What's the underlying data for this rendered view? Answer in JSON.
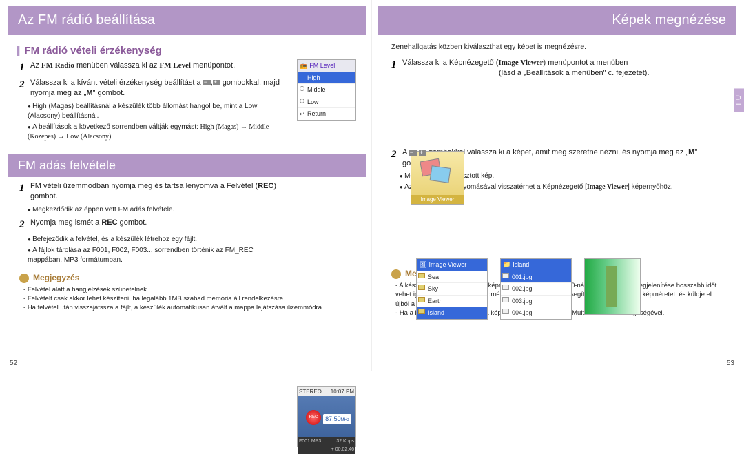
{
  "left": {
    "title": "Az FM rádió beállítása",
    "section1_title": "FM rádió vételi érzékenység",
    "step1_pre": "Az ",
    "step1_b1": "FM Radio",
    "step1_mid": " menüben válassza ki az ",
    "step1_b2": "FM Level",
    "step1_post": " menüpontot.",
    "step2_pre": "Válassza ki a kívánt vételi érzékenység beállítást a ",
    "step2_post1": " gombokkal, majd nyomja meg az „",
    "step2_b": "M",
    "step2_post2": "\" gombot.",
    "bullet1": "High (Magas) beállításnál a készülék több állomást hangol be, mint a Low (Alacsony) beállításnál.",
    "bullet2_pre": "A beállítások a következő sorrendben váltják egymást: ",
    "bullet2_seq": "High (Magas) → Middle (Közepes) → Low (Alacsony)",
    "fm_screen": {
      "title": "FM Level",
      "opt1": "High",
      "opt2": "Middle",
      "opt3": "Low",
      "opt4": "Return"
    },
    "subtitle": "FM adás felvétele",
    "rec_step1_pre": "FM vételi üzemmódban nyomja meg és tartsa lenyomva a Felvétel (",
    "rec_step1_b": "REC",
    "rec_step1_post": ") gombot.",
    "rec_bullet1": "Megkezdődik az éppen vett FM adás felvétele.",
    "rec_step2_pre": "Nyomja meg ismét a ",
    "rec_step2_b": "REC",
    "rec_step2_post": " gombot.",
    "rec_bullet2a": "Befejeződik a felvétel, és a készülék létrehoz egy fájlt.",
    "rec_bullet2b": "A fájlok tárolása az F001, F002, F003... sorrendben történik az FM_REC mappában, MP3 formátumban.",
    "rec_screen": {
      "stereo": "STEREO",
      "time": "10:07 PM",
      "rec": "REC",
      "freq": "87.50",
      "mhz": "MHz",
      "file": "F001.MP3",
      "kbps": "32 Kbps",
      "elapsed": "+ 00:02:46"
    },
    "note_label": "Megjegyzés",
    "note1": "Felvétel alatt a hangjelzések szünetelnek.",
    "note2": "Felvételt csak akkor lehet készíteni, ha legalább 1MB szabad memória áll rendelkezésre.",
    "note3": "Ha felvétel után visszajátssza a fájlt, a készülék automatikusan átvált a mappa lejátszása üzemmódra.",
    "page_num": "52"
  },
  "right": {
    "title": "Képek megnézése",
    "intro": "Zenehallgatás közben kiválaszthat egy képet is megnézésre.",
    "step1_pre": "Válassza ki a Képnézegető (",
    "step1_b": "Image Viewer",
    "step1_post1": ") menüpontot a menüben",
    "step1_post2": "(lásd a „Beállítások a menüben\" c. fejezetet).",
    "thumb_label": "Image Viewer",
    "step2_pre": "A ",
    "step2_mid": " gombokkal válassza ki a képet, amit meg szeretne nézni, és nyomja meg az „",
    "step2_b": "M",
    "step2_post": "\" gombot.",
    "bullet2a": "Megjelenik a kiválasztott kép.",
    "bullet2b_pre": "Az „",
    "bullet2b_b1": "M",
    "bullet2b_mid": "\" gomb megnyomásával visszatérhet a Képnézegető [",
    "bullet2b_b2": "Image Viewer",
    "bullet2b_post": "] képernyőhöz.",
    "browser1": {
      "header": "Image Viewer",
      "r1": "Sea",
      "r2": "Sky",
      "r3": "Earth",
      "r4": "Island"
    },
    "browser2": {
      "header": "Island",
      "r1": "001.jpg",
      "r2": "002.jpg",
      "r3": "003.jpg",
      "r4": "004.jpg"
    },
    "note_label": "Megjegyzés",
    "note1": "A készülék számára az ideális képméret a 96x96. A 800x600-nál nagyobb képek megjelenítése hosszabb időt vehet igénybe. Ha túl nagy a képméret, a Multimedia Studio segítségével állítsa be a képméretet, és küldje el újból a készülékre.",
    "note2": "Ha a képfájl nem jelenik meg a képernyőn, küldje el újból a Multimedia Studio segítségével.",
    "page_num": "53",
    "side_tab": "HU"
  }
}
